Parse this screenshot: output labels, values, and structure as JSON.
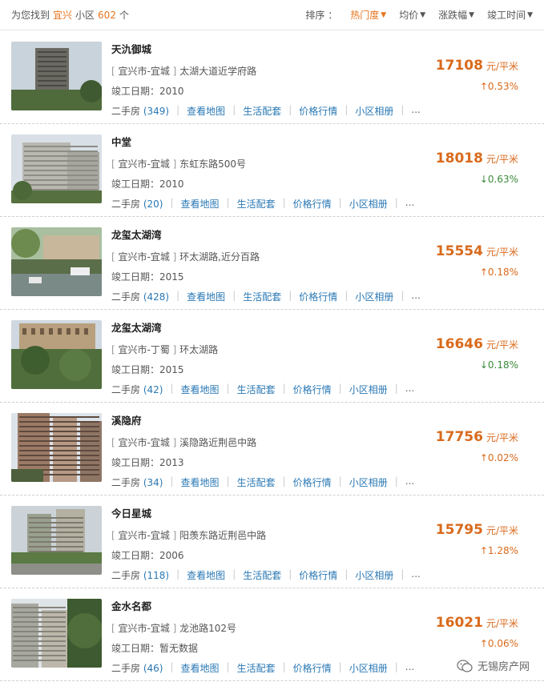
{
  "header": {
    "found_prefix": "为您找到",
    "city": "宜兴",
    "found_mid": "小区",
    "count": "602",
    "found_suffix": "个",
    "sort_label": "排序 ：",
    "sorts": [
      {
        "label": "热门度",
        "arrow": "▼",
        "active": true
      },
      {
        "label": "均价",
        "arrow": "▼",
        "active": false
      },
      {
        "label": "涨跌幅",
        "arrow": "▼",
        "active": false
      },
      {
        "label": "竣工时间",
        "arrow": "▼",
        "active": false
      }
    ]
  },
  "links": {
    "resale_prefix": "二手房",
    "map": "查看地图",
    "life": "生活配套",
    "price_trend": "价格行情",
    "album": "小区相册",
    "more": "..."
  },
  "price_unit": "元/平米",
  "listings": [
    {
      "name": "天氿御城",
      "district": "宜兴市-宜城",
      "address": "太湖大道近学府路",
      "built": "竣工日期：2010",
      "resale": "(349)",
      "price": "17108",
      "change": "↑0.53%",
      "trend": "up"
    },
    {
      "name": "中堂",
      "district": "宜兴市-宜城",
      "address": "东虹东路500号",
      "built": "竣工日期：2010",
      "resale": "(20)",
      "price": "18018",
      "change": "↓0.63%",
      "trend": "down"
    },
    {
      "name": "龙玺太湖湾",
      "district": "宜兴市-宜城",
      "address": "环太湖路,近分百路",
      "built": "竣工日期：2015",
      "resale": "(428)",
      "price": "15554",
      "change": "↑0.18%",
      "trend": "up"
    },
    {
      "name": "龙玺太湖湾",
      "district": "宜兴市-丁蜀",
      "address": "环太湖路",
      "built": "竣工日期：2015",
      "resale": "(42)",
      "price": "16646",
      "change": "↓0.18%",
      "trend": "down"
    },
    {
      "name": "溪隐府",
      "district": "宜兴市-宜城",
      "address": "溪隐路近荆邑中路",
      "built": "竣工日期：2013",
      "resale": "(34)",
      "price": "17756",
      "change": "↑0.02%",
      "trend": "up"
    },
    {
      "name": "今日星城",
      "district": "宜兴市-宜城",
      "address": "阳羡东路近荆邑中路",
      "built": "竣工日期：2006",
      "resale": "(118)",
      "price": "15795",
      "change": "↑1.28%",
      "trend": "up"
    },
    {
      "name": "金水名都",
      "district": "宜兴市-宜城",
      "address": "龙池路102号",
      "built": "竣工日期：暂无数据",
      "resale": "(46)",
      "price": "16021",
      "change": "↑0.06%",
      "trend": "up"
    }
  ],
  "watermark": "无锡房产网"
}
